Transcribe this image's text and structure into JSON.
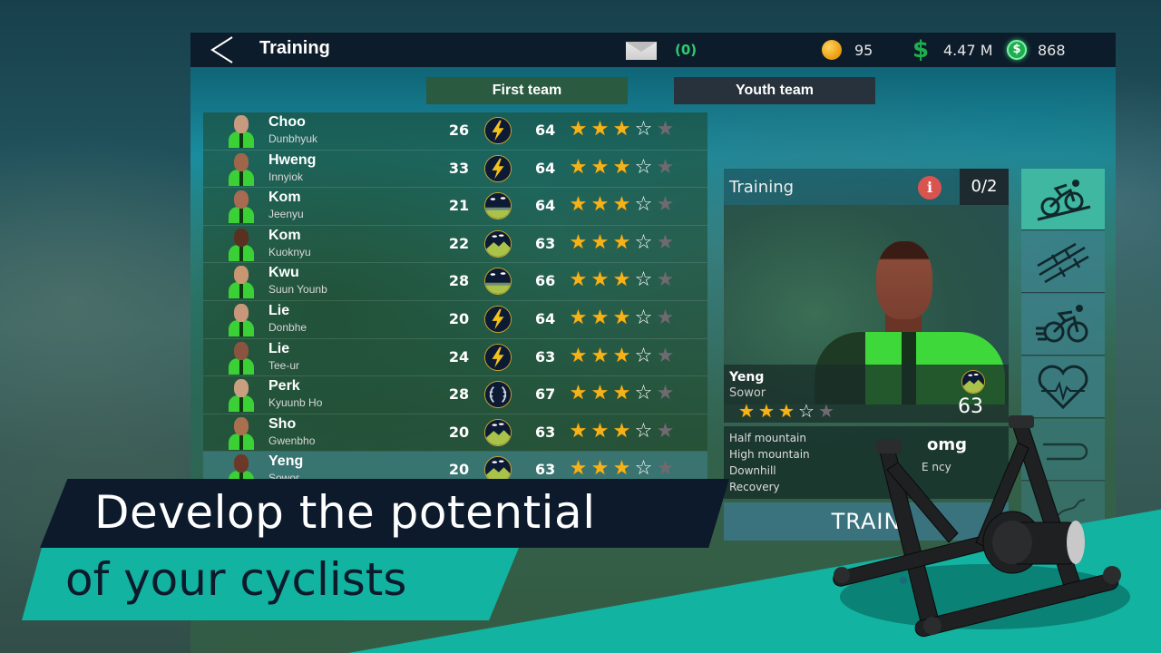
{
  "header": {
    "title": "Training",
    "mail_count": "(0)",
    "coins": "95",
    "cash": "4.47 M",
    "premium": "868",
    "cash_symbol": "$",
    "premium_symbol": "$"
  },
  "tabs": [
    {
      "label": "First team",
      "active": true
    },
    {
      "label": "Youth team",
      "active": false
    }
  ],
  "cyclists": [
    {
      "name": "Choo",
      "surname": "Dunbhyuk",
      "age": "26",
      "type": "sprinter",
      "ovr": "64",
      "stars": 3.5,
      "skin": "#c89a80",
      "selected": false
    },
    {
      "name": "Hweng",
      "surname": "Innyiok",
      "age": "33",
      "type": "sprinter",
      "ovr": "64",
      "stars": 3.5,
      "skin": "#a0664a",
      "selected": false
    },
    {
      "name": "Kom",
      "surname": "Jeenyu",
      "age": "21",
      "type": "flat",
      "ovr": "64",
      "stars": 3.5,
      "skin": "#a86a50",
      "selected": false
    },
    {
      "name": "Kom",
      "surname": "Kuoknyu",
      "age": "22",
      "type": "mountain",
      "ovr": "63",
      "stars": 3.5,
      "skin": "#5a3020",
      "selected": false
    },
    {
      "name": "Kwu",
      "surname": "Suun Younb",
      "age": "28",
      "type": "flat",
      "ovr": "66",
      "stars": 3.5,
      "skin": "#c89670",
      "selected": false
    },
    {
      "name": "Lie",
      "surname": "Donbhe",
      "age": "20",
      "type": "sprinter",
      "ovr": "64",
      "stars": 3.5,
      "skin": "#c8967a",
      "selected": false
    },
    {
      "name": "Lie",
      "surname": "Tee-ur",
      "age": "24",
      "type": "sprinter",
      "ovr": "63",
      "stars": 3.5,
      "skin": "#8a5440",
      "selected": false
    },
    {
      "name": "Perk",
      "surname": "Kyuunb Ho",
      "age": "28",
      "type": "allrounder",
      "ovr": "67",
      "stars": 3.5,
      "skin": "#c8a080",
      "selected": false
    },
    {
      "name": "Sho",
      "surname": "Gwenbho",
      "age": "20",
      "type": "mountain",
      "ovr": "63",
      "stars": 3.5,
      "skin": "#a8704e",
      "selected": false
    },
    {
      "name": "Yeng",
      "surname": "Sowor",
      "age": "20",
      "type": "mountain",
      "ovr": "63",
      "stars": 3.5,
      "skin": "#6e3828",
      "selected": true
    }
  ],
  "detail": {
    "title": "Training",
    "count": "0/2",
    "name": "Yeng",
    "surname": "Sowor",
    "stars": 3.5,
    "ovr": "63",
    "skills": [
      "Half mountain",
      "High mountain",
      "Downhill",
      "Recovery"
    ],
    "stat_value": "omg",
    "stat_label": "E      ncy",
    "train_label": "TRAIN"
  },
  "side_tabs": [
    {
      "icon": "climbing-cyclist-icon",
      "active": true
    },
    {
      "icon": "cobblestone-icon",
      "active": false
    },
    {
      "icon": "sprinting-cyclist-icon",
      "active": false
    },
    {
      "icon": "heart-rate-icon",
      "active": false
    },
    {
      "icon": "time-trial-icon",
      "active": false
    },
    {
      "icon": "downhill-road-icon",
      "active": false
    }
  ],
  "promo": {
    "line1": "Develop the potential",
    "line2": "of your cyclists"
  },
  "colors": {
    "topbar": "#0d1c2a",
    "tab_active": "#2a5a40",
    "tab_inactive": "#27323c",
    "star_full": "#f6b318",
    "star_empty": "#6f6a70",
    "accent_teal": "#12b3a0",
    "side_active": "#3fb7a1",
    "mail_count": "#2ecc71"
  }
}
